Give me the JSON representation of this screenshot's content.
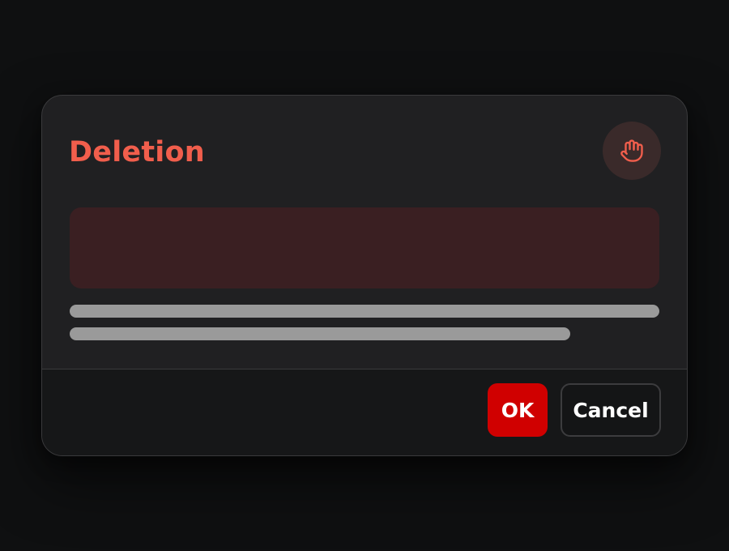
{
  "dialog": {
    "title": "Deletion",
    "icon": "hand-stop-icon",
    "accent_color": "#f15e4c",
    "danger_color": "#d00000",
    "buttons": {
      "ok_label": "OK",
      "cancel_label": "Cancel"
    }
  }
}
